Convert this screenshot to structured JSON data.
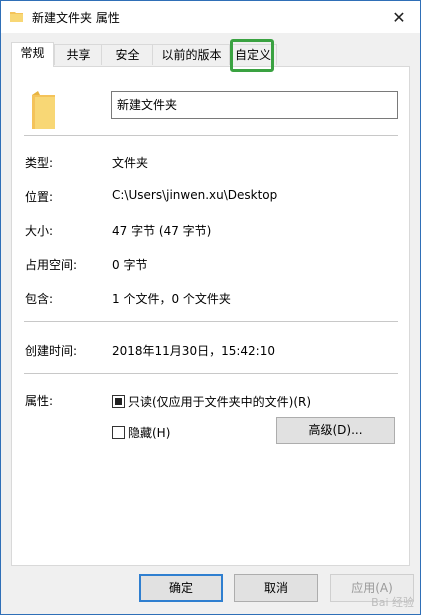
{
  "window": {
    "title": "新建文件夹 属性",
    "close_symbol": "✕"
  },
  "tabs": [
    {
      "label": "常规"
    },
    {
      "label": "共享"
    },
    {
      "label": "安全"
    },
    {
      "label": "以前的版本"
    },
    {
      "label": "自定义"
    }
  ],
  "general": {
    "folder_name": "新建文件夹",
    "type_label": "类型:",
    "type_value": "文件夹",
    "location_label": "位置:",
    "location_value": "C:\\Users\\jinwen.xu\\Desktop",
    "size_label": "大小:",
    "size_value": "47 字节 (47 字节)",
    "size_on_disk_label": "占用空间:",
    "size_on_disk_value": "0 字节",
    "contains_label": "包含:",
    "contains_value": "1 个文件，0 个文件夹",
    "created_label": "创建时间:",
    "created_value": "2018年11月30日，15:42:10",
    "attributes_label": "属性:",
    "readonly_label": "只读(仅应用于文件夹中的文件)(R)",
    "readonly_checked": true,
    "hidden_label": "隐藏(H)",
    "hidden_checked": false,
    "advanced_button": "高级(D)..."
  },
  "buttons": {
    "ok": "确定",
    "cancel": "取消",
    "apply": "应用(A)"
  },
  "watermark": "Bai 经验",
  "colors": {
    "highlight": "#3aa241",
    "folder": "#f4c35a",
    "focus_border": "#2f7fd0"
  }
}
